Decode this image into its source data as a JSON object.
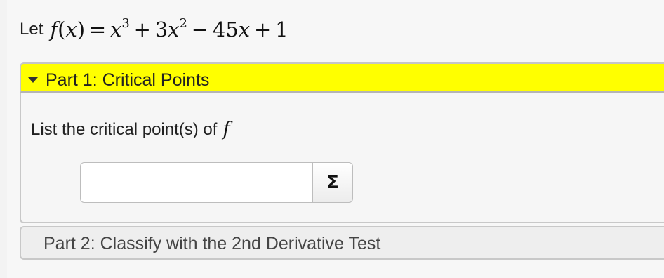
{
  "problem": {
    "let_label": "Let",
    "function_name": "f",
    "variable": "x",
    "rhs_term1_base": "x",
    "rhs_term1_exp": "3",
    "op1": "+",
    "rhs_term2_coef": "3",
    "rhs_term2_base": "x",
    "rhs_term2_exp": "2",
    "op2": "−",
    "rhs_term3_coef": "45",
    "rhs_term3_base": "x",
    "op3": "+",
    "rhs_term4": "1"
  },
  "part1": {
    "title": "Part 1: Critical Points",
    "expanded": true,
    "header_color": "#ffff00",
    "prompt": "List the critical point(s) of",
    "prompt_var": "f",
    "answer_value": "",
    "equation_button_icon": "sigma-icon",
    "equation_button_glyph": "Σ"
  },
  "part2": {
    "title": "Part 2: Classify with the 2nd Derivative Test",
    "expanded": false
  }
}
